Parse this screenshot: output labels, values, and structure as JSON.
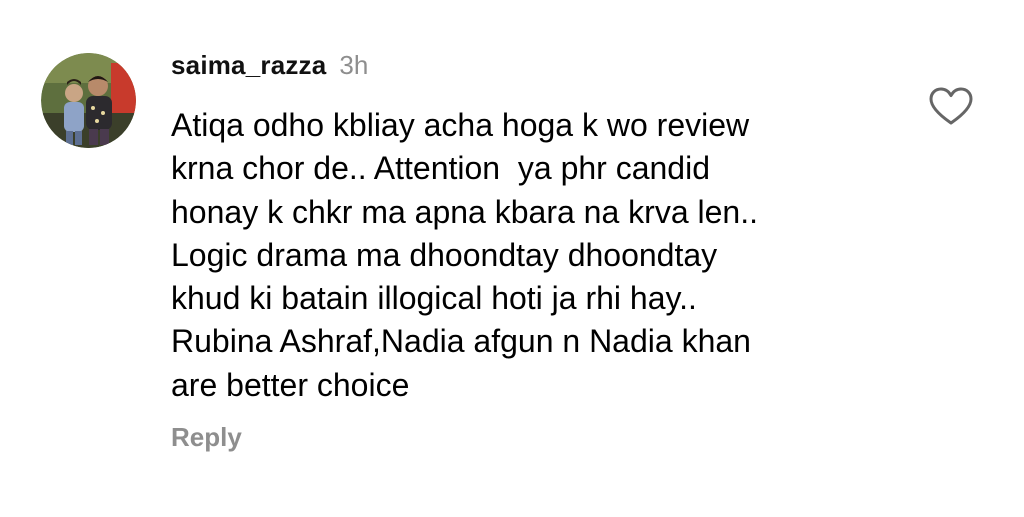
{
  "comment": {
    "username": "saima_razza",
    "timestamp": "3h",
    "text_lines": [
      "Atiqa odho kbliay acha hoga k wo review",
      "krna chor de.. Attention  ya phr candid",
      "honay k chkr ma apna kbara na krva len..",
      "Logic drama ma dhoondtay dhoondtay",
      "khud ki batain illogical hoti ja rhi hay..",
      "Rubina Ashraf,Nadia afgun n Nadia khan",
      "are better choice"
    ],
    "reply_label": "Reply",
    "like_icon": "heart-outline-icon",
    "avatar_icon": "profile-photo"
  },
  "colors": {
    "text": "#000000",
    "muted": "#8e8e8e",
    "background": "#ffffff"
  }
}
